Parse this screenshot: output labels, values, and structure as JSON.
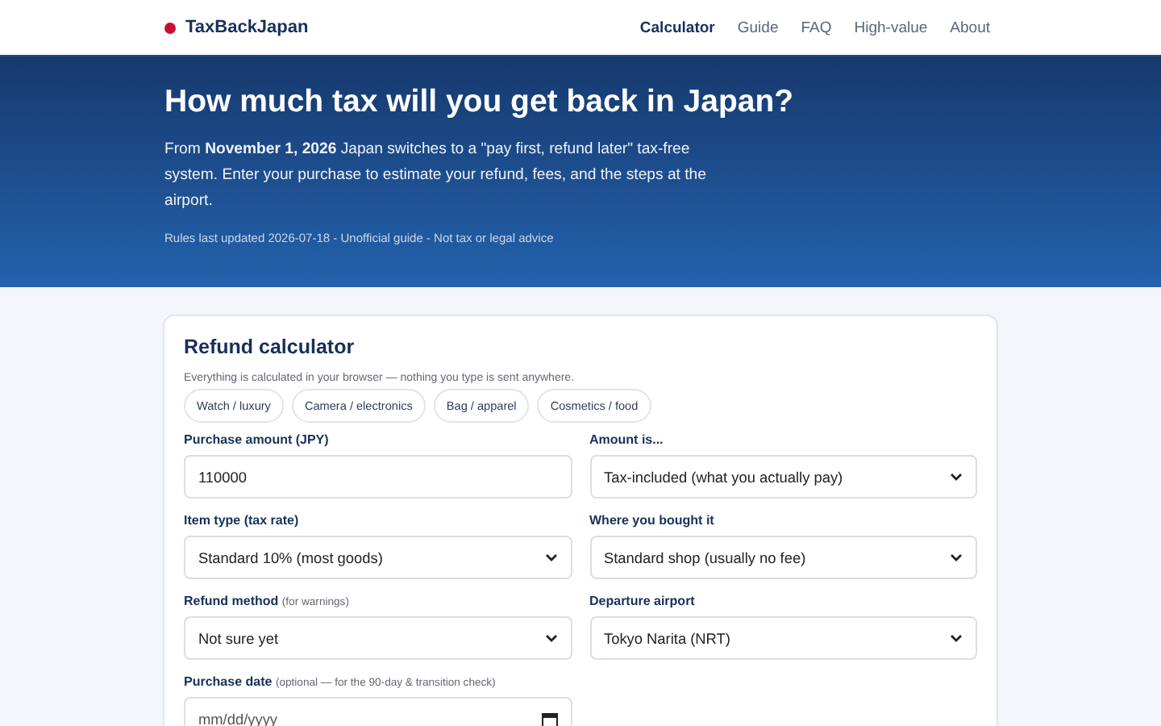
{
  "brand": {
    "name": "TaxBackJapan"
  },
  "nav": [
    {
      "label": "Calculator",
      "selected": true
    },
    {
      "label": "Guide",
      "selected": false
    },
    {
      "label": "FAQ",
      "selected": false
    },
    {
      "label": "High-value",
      "selected": false
    },
    {
      "label": "About",
      "selected": false
    }
  ],
  "hero": {
    "title": "How much tax will you get back in Japan?",
    "intro": "From **November 1, 2026** Japan switches to a \"pay first, refund later\" tax-free system. Enter your purchase to estimate your refund, fees, and the steps at the airport.",
    "meta": "Rules last updated 2026-07-18 - Unofficial guide - Not tax or legal advice"
  },
  "calculator": {
    "title": "Refund calculator",
    "note": "Everything is calculated in your browser — nothing you type is sent anywhere.",
    "presets": [
      "Watch / luxury",
      "Camera / electronics",
      "Bag / apparel",
      "Cosmetics / food"
    ],
    "fields": [
      {
        "kind": "input",
        "label": "Purchase amount (JPY)",
        "value": "110000"
      },
      {
        "kind": "select",
        "label": "Amount is...",
        "value": "Tax-included (what you actually pay)"
      },
      {
        "kind": "select",
        "label": "Item type (tax rate)",
        "value": "Standard 10% (most goods)"
      },
      {
        "kind": "select",
        "label": "Where you bought it",
        "value": "Standard shop (usually no fee)"
      },
      {
        "kind": "select",
        "label": "Refund method",
        "hint": "(for warnings)",
        "value": "Not sure yet"
      },
      {
        "kind": "select",
        "label": "Departure airport",
        "value": "Tokyo Narita (NRT)"
      },
      {
        "kind": "date",
        "label": "Purchase date",
        "hint": "(optional — for the 90-day & transition check)",
        "placeholder": "mm/dd/yyyy"
      }
    ]
  }
}
